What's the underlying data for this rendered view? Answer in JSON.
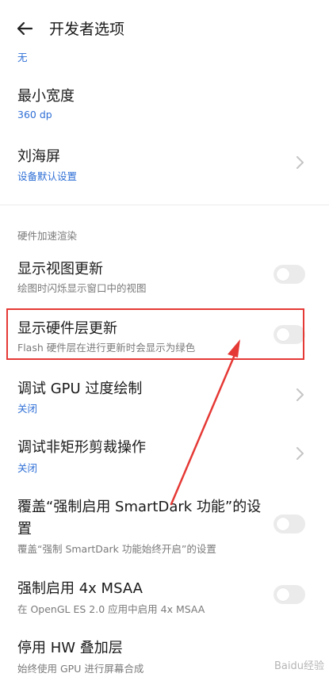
{
  "header": {
    "title": "开发者选项"
  },
  "top_truncated_value": "无",
  "items": [
    {
      "title": "最小宽度",
      "value": "360 dp"
    },
    {
      "title": "刘海屏",
      "value": "设备默认设置"
    }
  ],
  "section_title": "硬件加速渲染",
  "hw_items": [
    {
      "title": "显示视图更新",
      "desc": "绘图时闪烁显示窗口中的视图",
      "toggle_on": false
    },
    {
      "title": "显示硬件层更新",
      "desc": "Flash 硬件层在进行更新时会显示为绿色",
      "toggle_on": false
    },
    {
      "title": "调试 GPU 过度绘制",
      "value": "关闭"
    },
    {
      "title": "调试非矩形剪裁操作",
      "value": "关闭"
    },
    {
      "title_line1": "覆盖“强制启用 SmartDark 功能”的设",
      "title_line2": "置",
      "desc": "覆盖“强制 SmartDark 功能始终开启”的设置",
      "toggle_on": false
    },
    {
      "title": "强制启用 4x MSAA",
      "desc": "在 OpenGL ES 2.0 应用中启用 4x MSAA",
      "toggle_on": false
    },
    {
      "title": "停用 HW 叠加层",
      "desc": "始终使用 GPU 进行屏幕合成"
    }
  ],
  "watermark": "Baidu经验",
  "colors": {
    "accent_blue": "#2f6fd6",
    "highlight_red": "#e53935"
  }
}
